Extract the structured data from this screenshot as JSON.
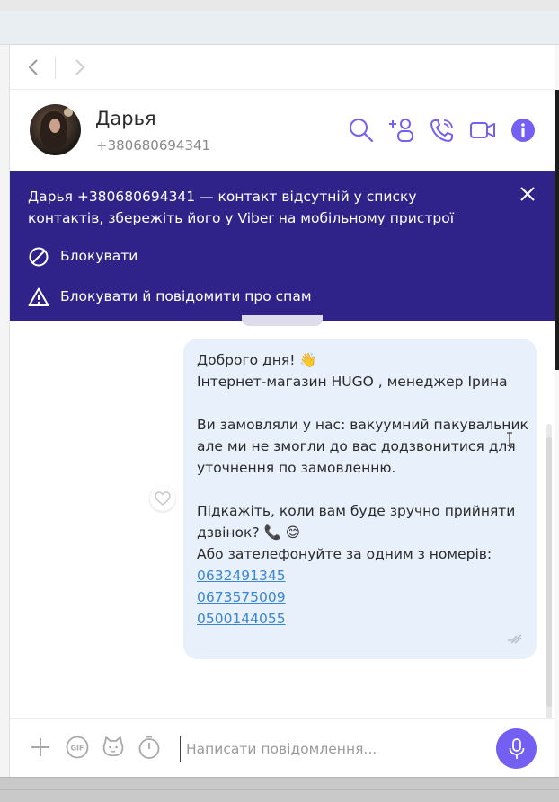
{
  "contact": {
    "name": "Дарья",
    "phone": "+380680694341"
  },
  "banner": {
    "text": "Дарья +380680694341 — контакт відсутній у списку контактів, збережіть його у Viber на мобільному пристрої",
    "block_label": "Блокувати",
    "block_spam_label": "Блокувати й повідомити про спам"
  },
  "message": {
    "line1": "Доброго дня! 👋",
    "line2": "Інтернет-магазин HUGO , менеджер Ірина",
    "line3": "Ви замовляли у нас: вакуумний пакувальник",
    "line4": "але ми не змогли до вас додзвонитися для",
    "line5": "уточнення по замовленню.",
    "line6": "Підкажіть, коли вам буде зручно прийняти",
    "line7": "дзвінок? 📞 😊",
    "line8": "Або зателефонуйте за одним з номерів:",
    "phones": [
      "0632491345",
      "0673575009",
      "0500144055"
    ]
  },
  "composer": {
    "placeholder": "Написати повідомлення..."
  },
  "colors": {
    "accent": "#7360f2",
    "banner_bg": "#2f2389",
    "bubble_bg": "#e8f0fb",
    "link": "#3a86d1"
  },
  "icons": {
    "header": [
      "search-icon",
      "add-participant-icon",
      "call-icon",
      "video-call-icon",
      "info-icon"
    ],
    "composer": [
      "plus-icon",
      "gif-icon",
      "sticker-icon",
      "timer-icon",
      "mic-icon"
    ]
  }
}
